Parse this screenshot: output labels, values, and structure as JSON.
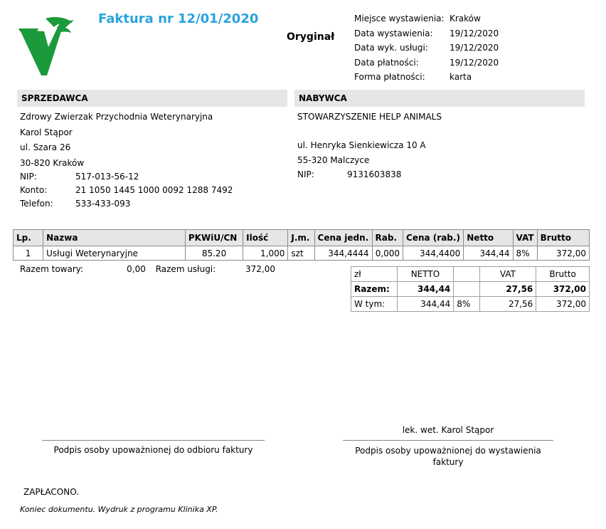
{
  "header": {
    "title": "Faktura nr 12/01/2020",
    "original": "Oryginał"
  },
  "meta": [
    {
      "label": "Miejsce wystawienia:",
      "value": "Kraków"
    },
    {
      "label": "Data wystawienia:",
      "value": "19/12/2020"
    },
    {
      "label": "Data wyk. usługi:",
      "value": "19/12/2020"
    },
    {
      "label": "Data płatności:",
      "value": "19/12/2020"
    },
    {
      "label": "Forma płatności:",
      "value": "karta"
    }
  ],
  "seller": {
    "heading": "SPRZEDAWCA",
    "name": "Zdrowy Zwierzak Przychodnia Weterynaryjna",
    "person": "Karol Stąpor",
    "street": "ul. Szara 26",
    "city": "30-820 Kraków",
    "nip_label": "NIP:",
    "nip": "517-013-56-12",
    "account_label": "Konto:",
    "account": "21 1050 1445 1000 0092 1288 7492",
    "phone_label": "Telefon:",
    "phone": "533-433-093"
  },
  "buyer": {
    "heading": "NABYWCA",
    "name": "STOWARZYSZENIE HELP ANIMALS",
    "street": "ul. Henryka Sienkiewicza 10 A",
    "city": "55-320 Malczyce",
    "nip_label": "NIP:",
    "nip": "9131603838"
  },
  "items": {
    "columns": [
      "Lp.",
      "Nazwa",
      "PKWiU/CN",
      "Ilość",
      "J.m.",
      "Cena jedn.",
      "Rab.",
      "Cena (rab.)",
      "Netto",
      "VAT",
      "Brutto"
    ],
    "rows": [
      [
        "1",
        "Usługi Weterynaryjne",
        "85.20",
        "1,000",
        "szt",
        "344,4444",
        "0,000",
        "344,4400",
        "344,44",
        "8%",
        "372,00"
      ]
    ]
  },
  "totals": {
    "goods_label": "Razem towary:",
    "goods": "0,00",
    "services_label": "Razem usługi:",
    "services": "372,00"
  },
  "summary": {
    "head": [
      "zł",
      "NETTO",
      "",
      "VAT",
      "Brutto"
    ],
    "total": [
      "Razem:",
      "344,44",
      "",
      "27,56",
      "372,00"
    ],
    "rows": [
      [
        "W tym:",
        "344,44",
        "8%",
        "27,56",
        "372,00"
      ]
    ]
  },
  "signatures": {
    "left_caption": "Podpis osoby upoważnionej do odbioru faktury",
    "right_name": "lek. wet. Karol Stąpor",
    "right_caption": "Podpis osoby upoważnionej do wystawienia faktury"
  },
  "footer": {
    "paid": "ZAPŁACONO.",
    "end": "Koniec dokumentu. Wydruk z programu Klinika XP."
  },
  "colors": {
    "title": "#29a3dc",
    "logo": "#1a9a3a",
    "header_bg": "#e6e6e6"
  }
}
